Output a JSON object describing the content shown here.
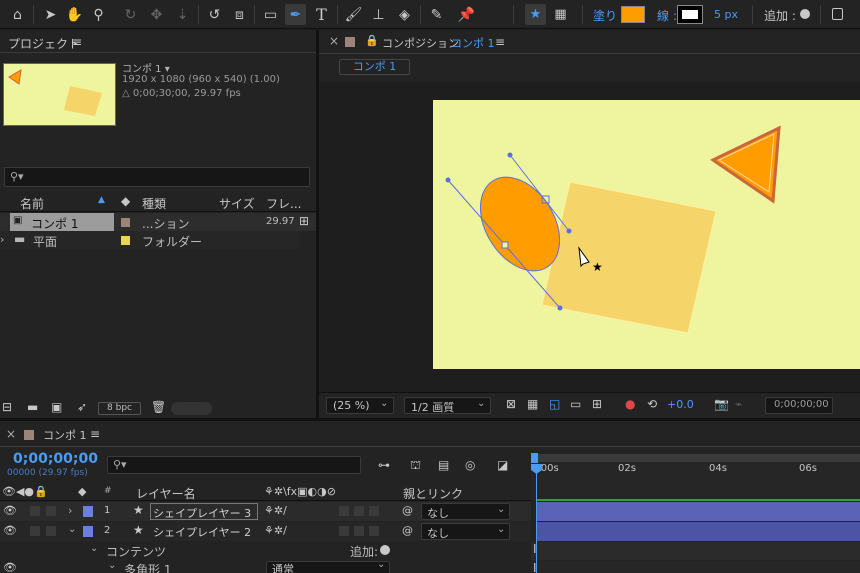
{
  "toolbar": {
    "tools": [
      "home-icon",
      "selection-icon",
      "hand-icon",
      "zoom-icon",
      "orbit-icon",
      "pan-icon",
      "dolly-icon",
      "rotate-icon",
      "camera-icon",
      "rectangle-icon",
      "pen-icon",
      "type-icon",
      "brush-icon",
      "clone-stamp-icon",
      "eraser-icon",
      "roto-brush-icon",
      "puppet-icon"
    ],
    "fill_label": "塗り :",
    "fill_color": "#ff9c00",
    "stroke_label": "線 :",
    "stroke_width": "5 px",
    "add_label": "追加 :"
  },
  "project": {
    "title": "プロジェクト",
    "menu": "≡",
    "comp_name": "コンポ 1 ▾",
    "comp_size": "1920 x 1080  (960 x 540) (1.00)",
    "comp_duration": "△ 0;00;30;00, 29.97 fps",
    "search_placeholder": "",
    "columns": [
      "名前",
      "種類",
      "サイズ",
      "フレ..."
    ],
    "items": [
      {
        "name": "コンポ 1",
        "type": "...ション",
        "size": "",
        "fps": "29.97",
        "color": "#9c8478"
      },
      {
        "name": "平面",
        "type": "フォルダー",
        "size": "",
        "fps": "",
        "color": "#e8d45a"
      }
    ],
    "bpc": "8 bpc"
  },
  "composition": {
    "tab_title": "コンポジション",
    "tab_comp": "コンポ 1",
    "menu": "≡",
    "subtab": "コンポ 1",
    "zoom": "(25 %)",
    "resolution": "1/2 画質",
    "exposure": "+0.0",
    "timecode": "0;00;00;00",
    "bg_color": "#eef59e"
  },
  "timeline": {
    "tab_title": "コンポ 1",
    "menu": "≡",
    "timecode": "0;00;00;00",
    "frame_info": "00000 (29.97 fps)",
    "search_placeholder": "",
    "ruler": [
      "0:00s",
      "02s",
      "04s",
      "06s"
    ],
    "col_num": "#",
    "col_layer": "レイヤー名",
    "col_parent": "親とリンク",
    "layers": [
      {
        "num": "1",
        "name": "シェイプレイヤー 3",
        "parent": "なし"
      },
      {
        "num": "2",
        "name": "シェイプレイヤー 2",
        "parent": "なし"
      }
    ],
    "contents_label": "コンテンツ",
    "add_label": "追加:",
    "polygon_label": "多角形 1",
    "blend_mode": "通常"
  }
}
